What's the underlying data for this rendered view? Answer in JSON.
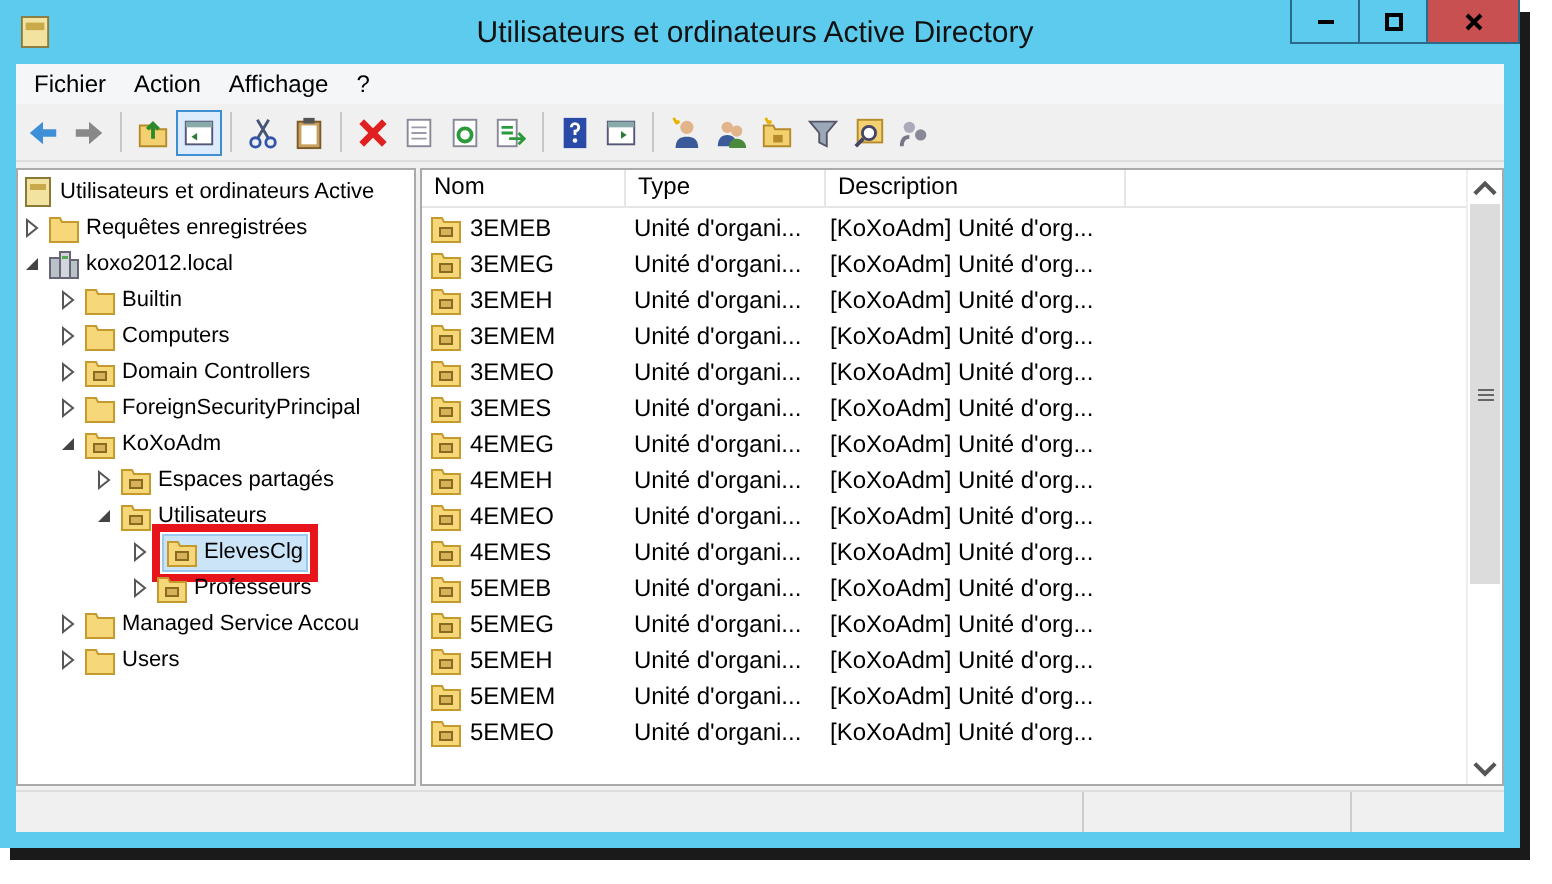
{
  "window": {
    "title": "Utilisateurs et ordinateurs Active Directory"
  },
  "menu": [
    "Fichier",
    "Action",
    "Affichage",
    "?"
  ],
  "toolbar": [
    [
      {
        "kind": "back",
        "selected": false
      },
      {
        "kind": "forward",
        "selected": false
      }
    ],
    [
      {
        "kind": "up",
        "selected": false
      },
      {
        "kind": "tree-pane",
        "selected": true
      }
    ],
    [
      {
        "kind": "cut",
        "selected": false
      },
      {
        "kind": "paste",
        "selected": false
      }
    ],
    [
      {
        "kind": "delete",
        "selected": false
      },
      {
        "kind": "properties",
        "selected": false
      },
      {
        "kind": "refresh",
        "selected": false
      },
      {
        "kind": "export",
        "selected": false
      }
    ],
    [
      {
        "kind": "help",
        "selected": false
      },
      {
        "kind": "action-pane",
        "selected": false
      }
    ],
    [
      {
        "kind": "new-user",
        "selected": false
      },
      {
        "kind": "new-group",
        "selected": false
      },
      {
        "kind": "new-ou",
        "selected": false
      },
      {
        "kind": "filter",
        "selected": false
      },
      {
        "kind": "find",
        "selected": false
      },
      {
        "kind": "delegate",
        "selected": false
      }
    ]
  ],
  "tree": [
    {
      "label": "Utilisateurs et ordinateurs Active",
      "kind": "root",
      "selected": false,
      "children": [
        {
          "label": "Requêtes enregistrées",
          "kind": "folder",
          "expanded": false,
          "selected": false
        },
        {
          "label": "koxo2012.local",
          "kind": "domain",
          "expanded": true,
          "selected": false,
          "children": [
            {
              "label": "Builtin",
              "kind": "folder",
              "expanded": false,
              "selected": false
            },
            {
              "label": "Computers",
              "kind": "folder",
              "expanded": false,
              "selected": false
            },
            {
              "label": "Domain Controllers",
              "kind": "ou",
              "expanded": false,
              "selected": false
            },
            {
              "label": "ForeignSecurityPrincipal",
              "kind": "folder",
              "expanded": false,
              "selected": false
            },
            {
              "label": "KoXoAdm",
              "kind": "ou",
              "expanded": true,
              "selected": false,
              "children": [
                {
                  "label": "Espaces partagés",
                  "kind": "ou",
                  "expanded": false,
                  "selected": false
                },
                {
                  "label": "Utilisateurs",
                  "kind": "ou",
                  "expanded": true,
                  "selected": false,
                  "children": [
                    {
                      "label": "ElevesClg",
                      "kind": "ou",
                      "expanded": false,
                      "selected": true,
                      "highlighted": true
                    },
                    {
                      "label": "Professeurs",
                      "kind": "ou",
                      "expanded": false,
                      "selected": false
                    }
                  ]
                }
              ]
            },
            {
              "label": "Managed Service Accou",
              "kind": "folder",
              "expanded": false,
              "selected": false
            },
            {
              "label": "Users",
              "kind": "folder",
              "expanded": false,
              "selected": false
            }
          ]
        }
      ]
    }
  ],
  "table": {
    "columns": [
      "Nom",
      "Type",
      "Description"
    ],
    "rows": [
      [
        "3EMEB",
        "Unité d'organi...",
        "[KoXoAdm] Unité d'org..."
      ],
      [
        "3EMEG",
        "Unité d'organi...",
        "[KoXoAdm] Unité d'org..."
      ],
      [
        "3EMEH",
        "Unité d'organi...",
        "[KoXoAdm] Unité d'org..."
      ],
      [
        "3EMEM",
        "Unité d'organi...",
        "[KoXoAdm] Unité d'org..."
      ],
      [
        "3EMEO",
        "Unité d'organi...",
        "[KoXoAdm] Unité d'org..."
      ],
      [
        "3EMES",
        "Unité d'organi...",
        "[KoXoAdm] Unité d'org..."
      ],
      [
        "4EMEG",
        "Unité d'organi...",
        "[KoXoAdm] Unité d'org..."
      ],
      [
        "4EMEH",
        "Unité d'organi...",
        "[KoXoAdm] Unité d'org..."
      ],
      [
        "4EMEO",
        "Unité d'organi...",
        "[KoXoAdm] Unité d'org..."
      ],
      [
        "4EMES",
        "Unité d'organi...",
        "[KoXoAdm] Unité d'org..."
      ],
      [
        "5EMEB",
        "Unité d'organi...",
        "[KoXoAdm] Unité d'org..."
      ],
      [
        "5EMEG",
        "Unité d'organi...",
        "[KoXoAdm] Unité d'org..."
      ],
      [
        "5EMEH",
        "Unité d'organi...",
        "[KoXoAdm] Unité d'org..."
      ],
      [
        "5EMEM",
        "Unité d'organi...",
        "[KoXoAdm] Unité d'org..."
      ],
      [
        "5EMEO",
        "Unité d'organi...",
        "[KoXoAdm] Unité d'org..."
      ]
    ]
  }
}
